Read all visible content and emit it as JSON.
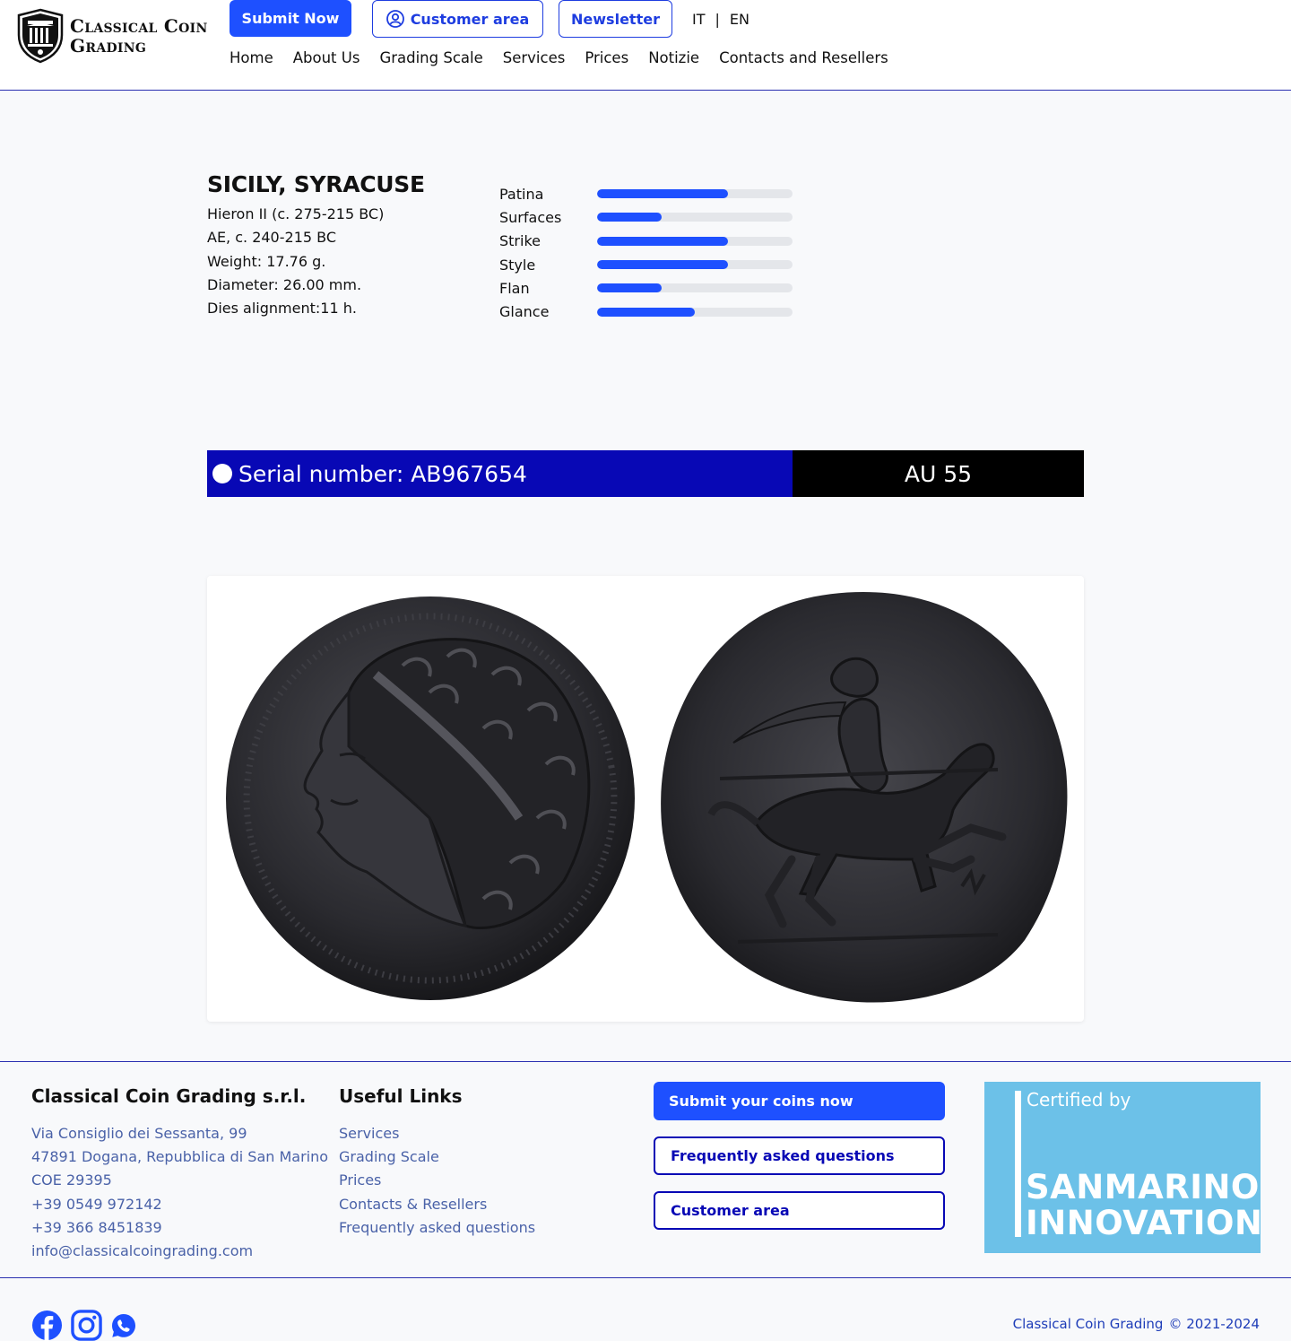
{
  "header": {
    "logo_line1": "Classical Coin",
    "logo_line2": "Grading",
    "submit_label": "Submit Now",
    "customer_label": "Customer area",
    "newsletter_label": "Newsletter",
    "lang_it": "IT",
    "lang_sep": "|",
    "lang_en": "EN",
    "nav": [
      "Home",
      "About Us",
      "Grading Scale",
      "Services",
      "Prices",
      "Notizie",
      "Contacts and Resellers"
    ]
  },
  "coin": {
    "title": "SICILY, SYRACUSE",
    "ruler": "Hieron II (c. 275-215 BC)",
    "metal_date": "AE, c. 240-215 BC",
    "weight": "Weight: 17.76 g.",
    "diameter": "Diameter: 26.00 mm.",
    "dies": "Dies alignment:11 h."
  },
  "metrics": [
    {
      "label": "Patina",
      "value": 0.67
    },
    {
      "label": "Surfaces",
      "value": 0.33
    },
    {
      "label": "Strike",
      "value": 0.67
    },
    {
      "label": "Style",
      "value": 0.67
    },
    {
      "label": "Flan",
      "value": 0.33
    },
    {
      "label": "Glance",
      "value": 0.5
    }
  ],
  "serial": {
    "label": "Serial number: AB967654",
    "grade": "AU 55"
  },
  "footer": {
    "company_title": "Classical Coin Grading s.r.l.",
    "address": [
      "Via Consiglio dei Sessanta, 99",
      "47891 Dogana, Repubblica di San Marino",
      "COE 29395",
      "+39 0549 972142",
      "+39 366 8451839",
      "info@classicalcoingrading.com"
    ],
    "links_title": "Useful Links",
    "links": [
      "Services",
      "Grading Scale",
      "Prices",
      "Contacts & Resellers",
      "Frequently asked questions"
    ],
    "btn_submit": "Submit your coins now",
    "btn_faq": "Frequently asked questions",
    "btn_customer": "Customer area",
    "cert_by": "Certified by",
    "cert_line1": "SANMARINO",
    "cert_line2": "INNOVATION",
    "copyright_name": "Classical Coin Grading",
    "copyright_years": "© 2021-2024"
  },
  "colors": {
    "accent": "#1e50ff",
    "navy": "#0808b5",
    "cert_bg": "#6cc1e8"
  }
}
